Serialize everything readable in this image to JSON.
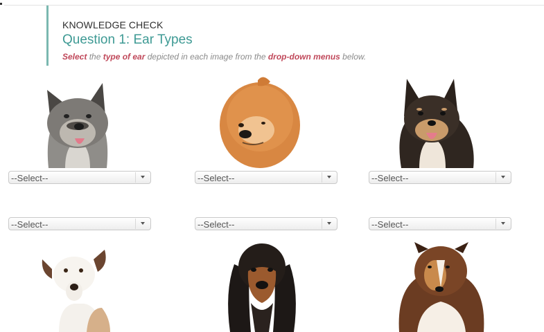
{
  "header": {
    "eyebrow": "KNOWLEDGE CHECK",
    "title": "Question 1: Ear Types",
    "instruction_parts": [
      "Select",
      " the ",
      "type of ear",
      " depicted in each image from the ",
      "drop-down menus",
      " below."
    ]
  },
  "selects": [
    {
      "value": "--Select--"
    },
    {
      "value": "--Select--"
    },
    {
      "value": "--Select--"
    },
    {
      "value": "--Select--"
    },
    {
      "value": "--Select--"
    },
    {
      "value": "--Select--"
    }
  ],
  "colors": {
    "accent_teal": "#3e9a94",
    "emphasis_red": "#c0485a"
  }
}
